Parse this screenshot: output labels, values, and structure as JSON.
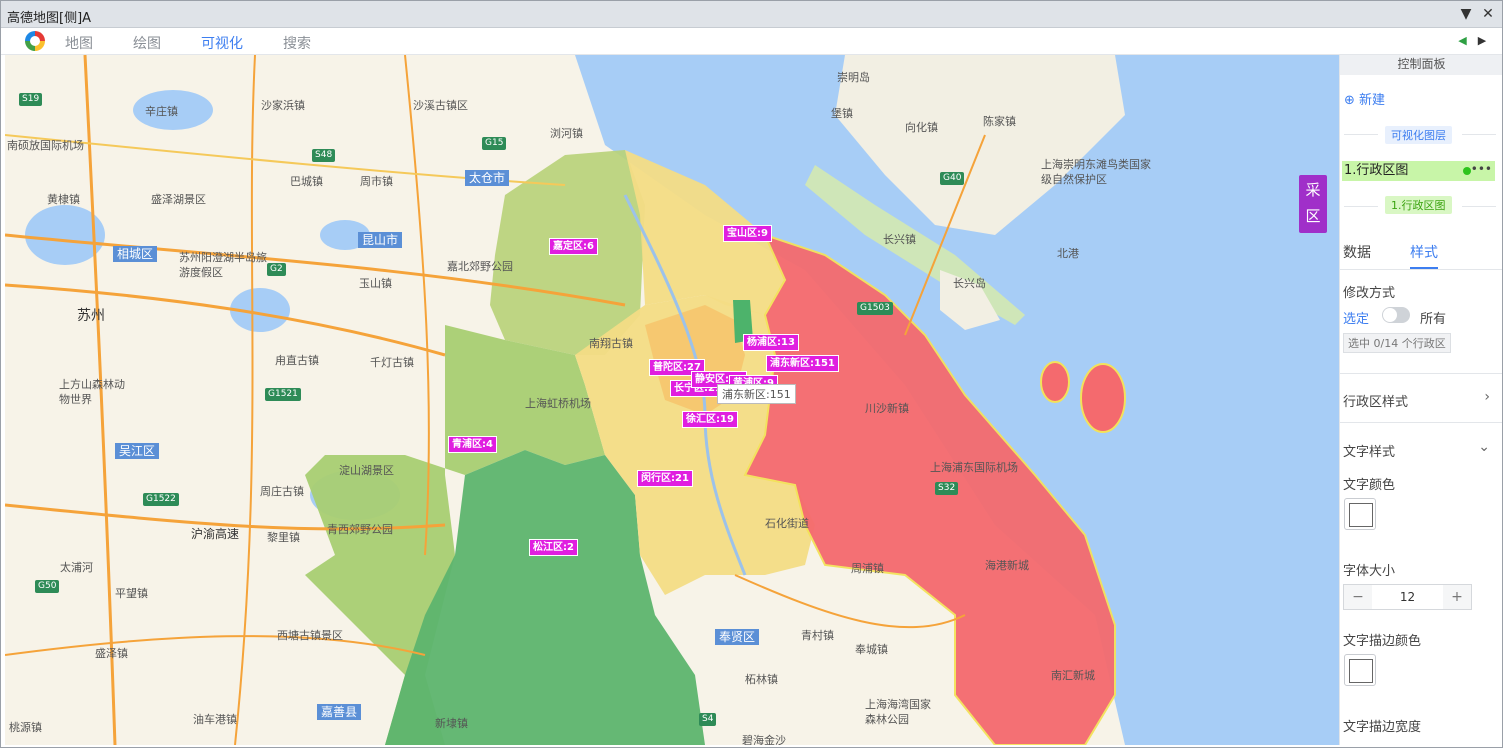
{
  "window": {
    "title": "高德地图[侧]A"
  },
  "tabs": [
    "地图",
    "绘图",
    "可视化",
    "搜索"
  ],
  "map": {
    "labels": {
      "suzhou": "苏州",
      "kunshan": "昆山市",
      "taicang": "太仓市",
      "wujiang": "吴江区",
      "xiangcheng": "相城区",
      "jiashan": "嘉善县",
      "fengxian": "奉贤区",
      "chongming_town": "崇明岛",
      "baozhen": "堡镇",
      "xianghua": "向化镇",
      "chenjia": "陈家镇",
      "chongming_reserve": "上海崇明东滩鸟类国家级自然保护区",
      "changxing_town": "长兴镇",
      "changxing_island": "长兴岛",
      "beigang": "北港",
      "shaxi": "沙溪古镇区",
      "liuhe": "浏河镇",
      "shajiabang": "沙家浜镇",
      "xincheng": "辛庄镇",
      "airport_nanshuo": "南硕放国际机场",
      "huangdai": "黄棣镇",
      "shengze": "盛泽湖景区",
      "yangcheng": "苏州阳澄湖半岛旅游度假区",
      "zhouzhuang_nan": "甪直古镇",
      "qiandeng": "千灯古镇",
      "shangfang": "上方山森林动物世界",
      "tongli": "周庄古镇",
      "liantang": "黎里镇",
      "hu_yu": "沪渝高速",
      "dapu": "太浦河",
      "pingwang": "平望镇",
      "shengze2": "盛泽镇",
      "xitang": "西塘古镇景区",
      "youche": "油车港镇",
      "taohu": "桃源镇",
      "xindai": "新埭镇",
      "fengcheng": "青村镇",
      "zhelin": "柘林镇",
      "fengcheng2": "奉城镇",
      "haiwan": "上海海湾国家森林公园",
      "bihai": "碧海金沙",
      "pudong_airport": "上海浦东国际机场",
      "zhoupu": "周浦镇",
      "nanhui": "南汇新城",
      "hongqiao": "上海虹桥机场",
      "dianshan": "淀山湖景区",
      "qingxi": "青西郊野公园",
      "jiabei": "嘉北郊野公园",
      "bashi": "巴城镇",
      "zhoushi": "周市镇",
      "yushan": "玉山镇",
      "nanxiang": "南翔古镇",
      "chuansha": "川沙新镇",
      "shisheng": "石化街道",
      "haigang": "海港新城",
      "g15": "G15",
      "g40": "G40",
      "s48": "S48",
      "g2": "G2",
      "g1521": "G1521",
      "g1522": "G1522",
      "g50": "G50",
      "s19": "S19",
      "g1503": "G1503",
      "s4": "S4",
      "s32": "S32"
    },
    "districts": [
      {
        "name": "嘉定区:6"
      },
      {
        "name": "宝山区:9"
      },
      {
        "name": "杨浦区:13"
      },
      {
        "name": "浦东新区:151"
      },
      {
        "name": "普陀区:27"
      },
      {
        "name": "长宁区:21"
      },
      {
        "name": "静安区:27"
      },
      {
        "name": "黄浦区:9"
      },
      {
        "name": "徐汇区:19"
      },
      {
        "name": "青浦区:4"
      },
      {
        "name": "闵行区:21"
      },
      {
        "name": "松江区:2"
      }
    ],
    "tooltip": "浦东新区:151",
    "collect_button": "采区",
    "colors": {
      "pudong": "#f46a6e",
      "yellow": "#f3dc85",
      "lightgreen": "#a8cd72",
      "green": "#5db46e",
      "water": "#a7cdf6"
    }
  },
  "panel": {
    "header": "控制面板",
    "new_button": "新建",
    "layer_section": "可视化图层",
    "layer_item": "1.行政区图",
    "layer_tag": "1.行政区图",
    "tab_data": "数据",
    "tab_style": "样式",
    "modify_mode_label": "修改方式",
    "selected": "选定",
    "all": "所有",
    "selection_info": "选中 0/14 个行政区",
    "district_style": "行政区样式",
    "text_style": "文字样式",
    "text_color": "文字颜色",
    "font_size_label": "字体大小",
    "font_size_value": "12",
    "stroke_color": "文字描边颜色",
    "stroke_width": "文字描边宽度"
  }
}
